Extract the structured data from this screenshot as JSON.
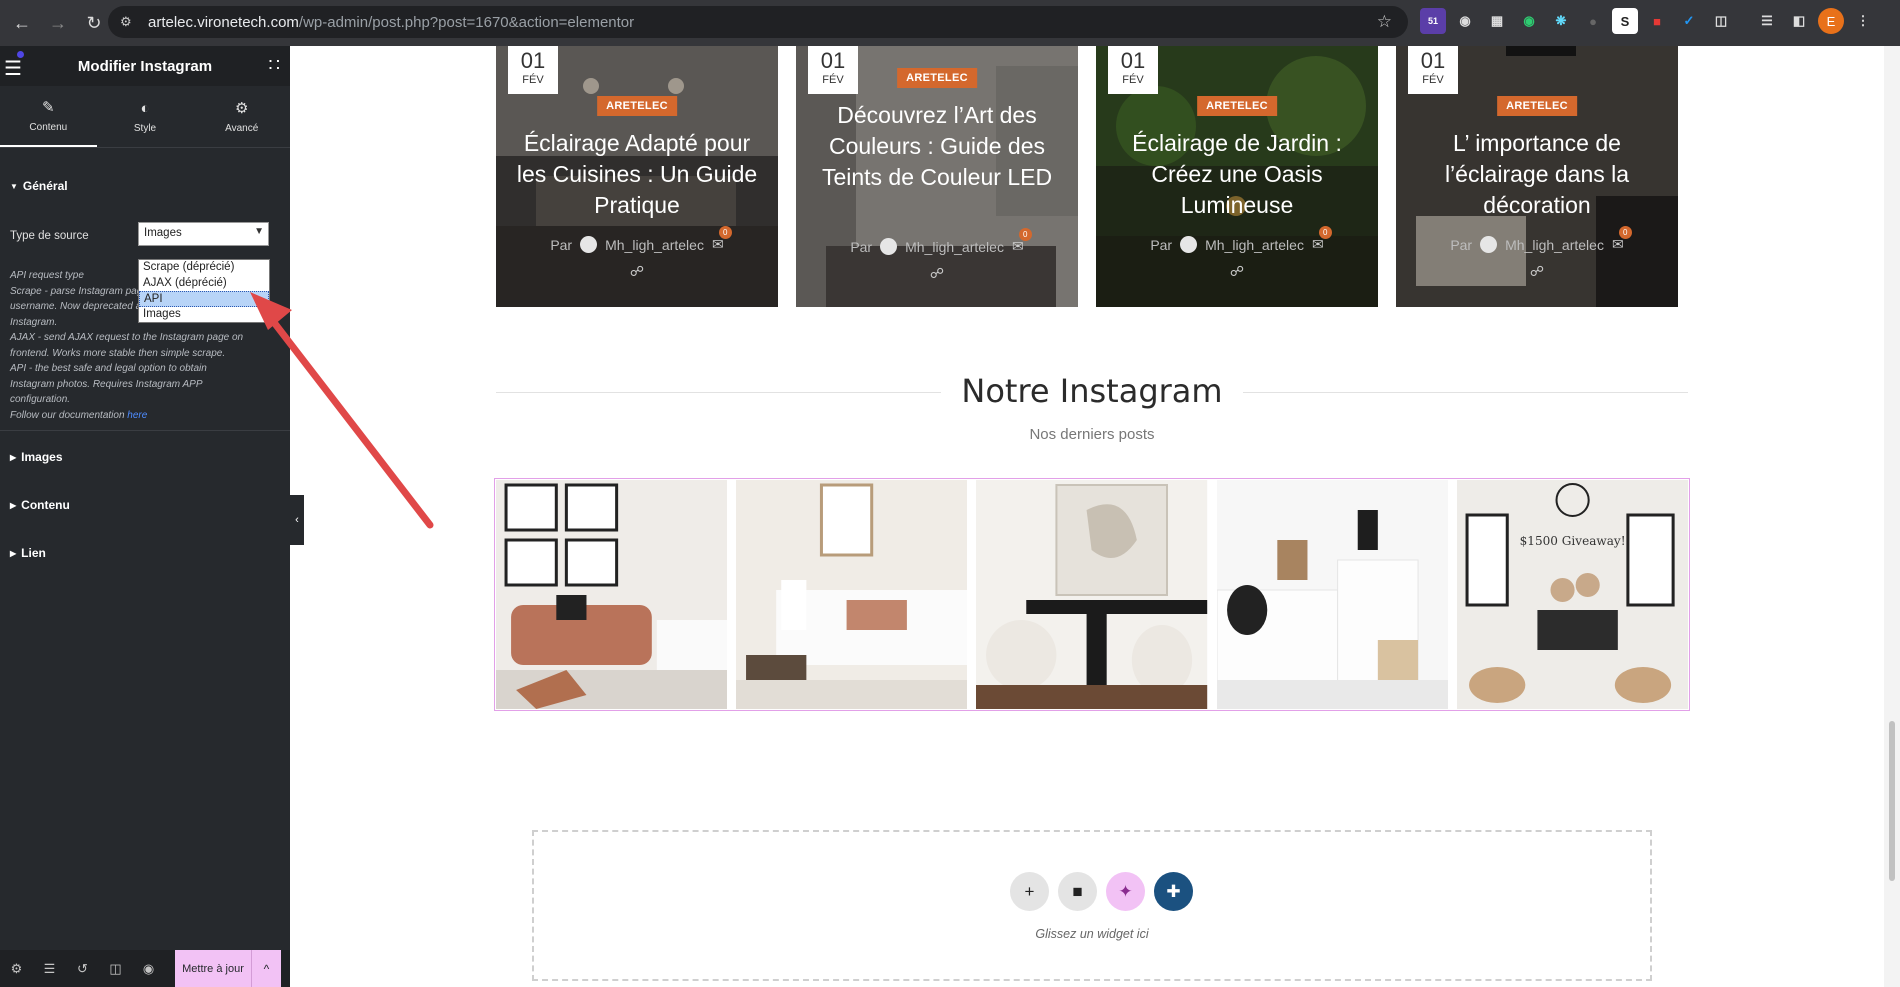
{
  "browser": {
    "url_host": "artelec.vironetech.com",
    "url_path": "/wp-admin/post.php?post=1670&action=elementor",
    "ext_badge": "51",
    "profile_initial": "E"
  },
  "panel": {
    "title": "Modifier Instagram",
    "tabs": [
      {
        "label": "Contenu",
        "icon": "pencil-icon"
      },
      {
        "label": "Style",
        "icon": "contrast-icon"
      },
      {
        "label": "Avancé",
        "icon": "gear-icon"
      }
    ],
    "general": {
      "heading": "Général",
      "source_label": "Type de source",
      "source_value": "Images",
      "options": [
        "Scrape (déprécié)",
        "AJAX (déprécié)",
        "API",
        "Images"
      ],
      "highlighted_option": "API",
      "help_lines": [
        "API request type",
        "Scrape - parse Instagram page to get photos by",
        "username. Now deprecated and does not work in",
        "Instagram.",
        "AJAX - send AJAX request to the Instagram page on",
        "frontend. Works more stable then simple scrape.",
        "API - the best safe and legal option to obtain",
        "Instagram photos. Requires Instagram APP",
        "configuration."
      ],
      "help_doc_prefix": "Follow our documentation ",
      "help_doc_link": "here"
    },
    "sections": [
      "Images",
      "Contenu",
      "Lien"
    ],
    "footer": {
      "update_label": "Mettre à jour"
    }
  },
  "posts": [
    {
      "day": "01",
      "month": "FÉV",
      "category": "ARETELEC",
      "title": "Éclairage Adapté pour les Cuisines : Un Guide Pratique",
      "author_prefix": "Par",
      "author": "Mh_ligh_artelec",
      "comments": "0"
    },
    {
      "day": "01",
      "month": "FÉV",
      "category": "ARETELEC",
      "title": "Découvrez l’Art des Couleurs : Guide des Teints de Couleur LED",
      "author_prefix": "Par",
      "author": "Mh_ligh_artelec",
      "comments": "0"
    },
    {
      "day": "01",
      "month": "FÉV",
      "category": "ARETELEC",
      "title": "Éclairage de Jardin : Créez une Oasis Lumineuse",
      "author_prefix": "Par",
      "author": "Mh_ligh_artelec",
      "comments": "0"
    },
    {
      "day": "01",
      "month": "FÉV",
      "category": "ARETELEC",
      "title": "L’ importance de l’éclairage dans la décoration",
      "author_prefix": "Par",
      "author": "Mh_ligh_artelec",
      "comments": "0"
    }
  ],
  "instagram": {
    "title": "Notre Instagram",
    "subtitle": "Nos derniers posts",
    "giveaway_text": "$1500 Giveaway!"
  },
  "dropzone": {
    "text": "Glissez un widget ici"
  },
  "colors": {
    "accent_pink": "#f2c2f5",
    "category_orange": "#d4682d",
    "panel_bg": "#26292d",
    "arrow_red": "#e04848"
  }
}
